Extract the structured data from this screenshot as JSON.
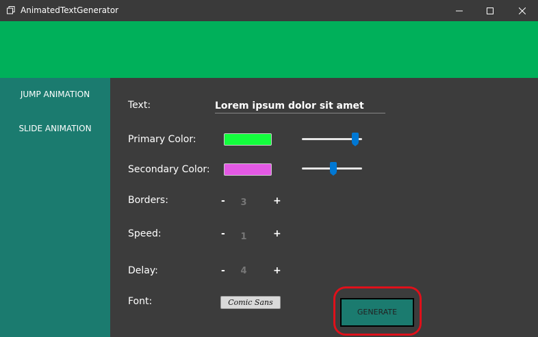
{
  "window": {
    "title": "AnimatedTextGenerator"
  },
  "sidebar": {
    "items": [
      {
        "label": "JUMP ANIMATION"
      },
      {
        "label": "SLIDE ANIMATION"
      }
    ]
  },
  "form": {
    "text": {
      "label": "Text:",
      "value": "Lorem ipsum dolor sit amet"
    },
    "primary_color": {
      "label": "Primary Color:",
      "swatch": "#13ff3d",
      "slider_value": 0.93
    },
    "secondary_color": {
      "label": "Secondary Color:",
      "swatch": "#e359e4",
      "slider_value": 0.53
    },
    "borders": {
      "label": "Borders:",
      "value": "3",
      "minus": "-",
      "plus": "+"
    },
    "speed": {
      "label": "Speed:",
      "value": "1",
      "minus": "-",
      "plus": "+"
    },
    "delay": {
      "label": "Delay:",
      "value": "4",
      "minus": "-",
      "plus": "+"
    },
    "font": {
      "label": "Font:",
      "value": "Comic Sans"
    }
  },
  "generate": {
    "label": "GENERATE"
  },
  "colors": {
    "header": "#00b05a",
    "sidebar": "#1b7b6f",
    "highlight": "#e0101a"
  }
}
